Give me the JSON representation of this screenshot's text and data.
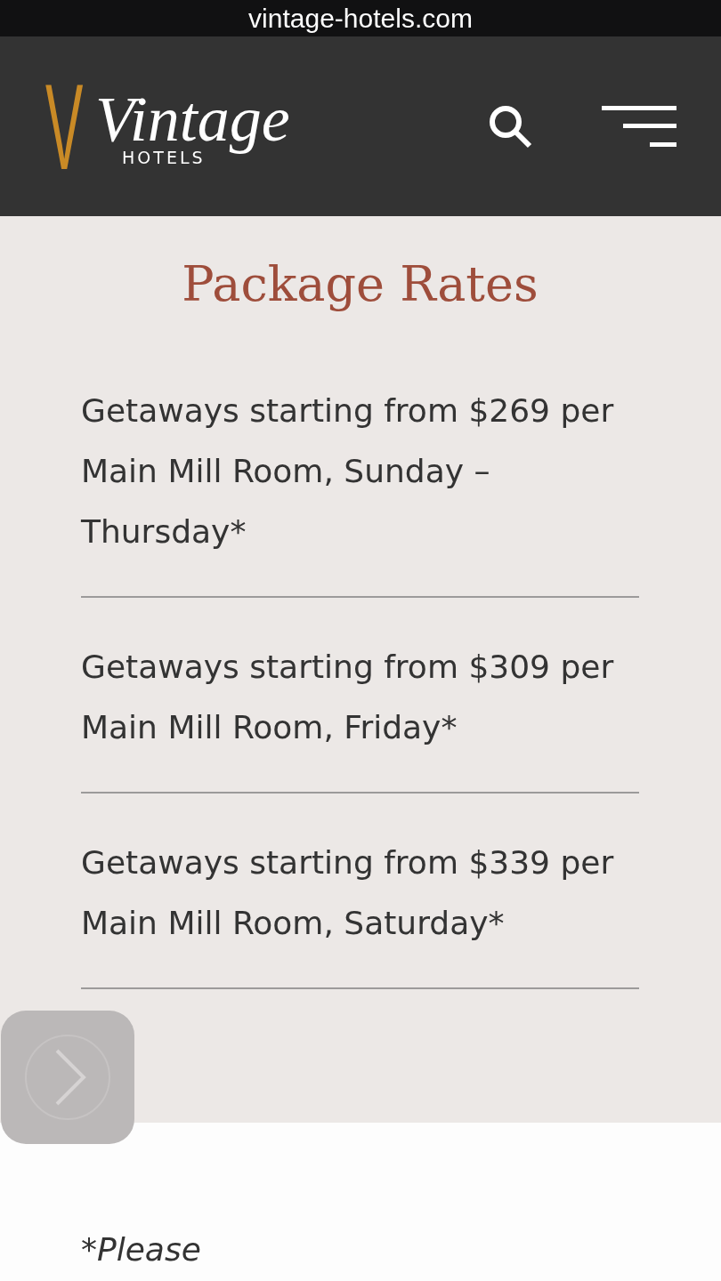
{
  "browser": {
    "url": "vintage-hotels.com"
  },
  "header": {
    "logo": {
      "mark": "V",
      "script": "Vintage",
      "subtitle": "HOTELS"
    }
  },
  "section": {
    "title": "Package Rates",
    "rates": [
      {
        "text": "Getaways starting from $269 per Main Mill Room, Sunday – Thursday*"
      },
      {
        "text": "Getaways starting from $309 per Main Mill Room, Friday*"
      },
      {
        "text": "Getaways starting from $339 per Main Mill Room, Saturday*"
      }
    ]
  },
  "footnote": "*Please"
}
